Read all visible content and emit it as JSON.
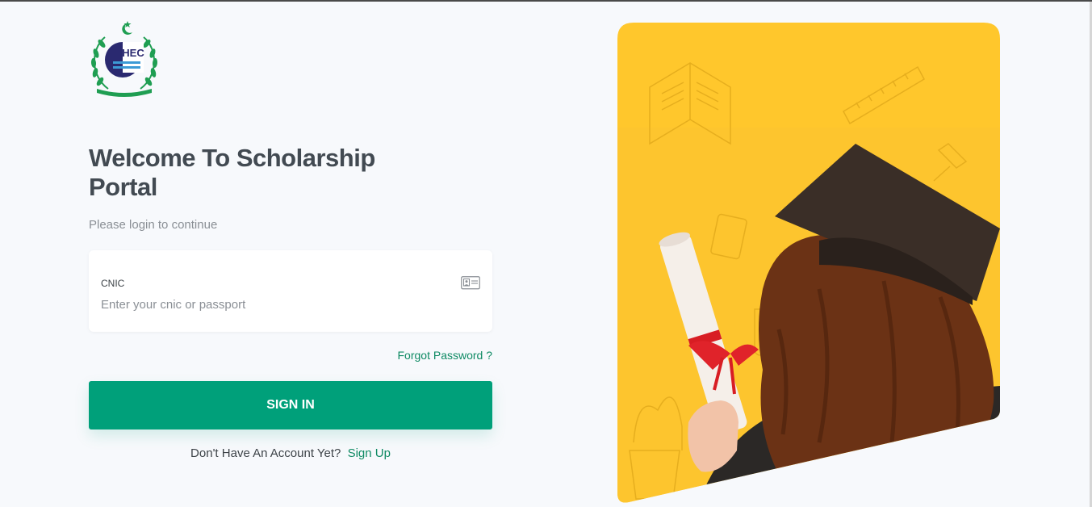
{
  "page": {
    "title": "Welcome To Scholarship Portal",
    "subtitle": "Please login to continue"
  },
  "logo": {
    "name": "hec-logo-icon",
    "text": "HEC"
  },
  "form": {
    "cnic_label": "CNIC",
    "cnic_placeholder": "Enter your cnic or passport",
    "cnic_value": "",
    "id_icon": "id-card-icon",
    "forgot_password": "Forgot Password ?",
    "signin_label": "SIGN IN",
    "no_account_text": "Don't Have An Account Yet?",
    "signup_link": "Sign Up"
  },
  "hero": {
    "image": "graduate-with-diploma-illustration"
  },
  "colors": {
    "accent": "#00a07a",
    "link": "#0e8a63",
    "hero_bg": "#ffc72c",
    "title": "#424a52"
  }
}
